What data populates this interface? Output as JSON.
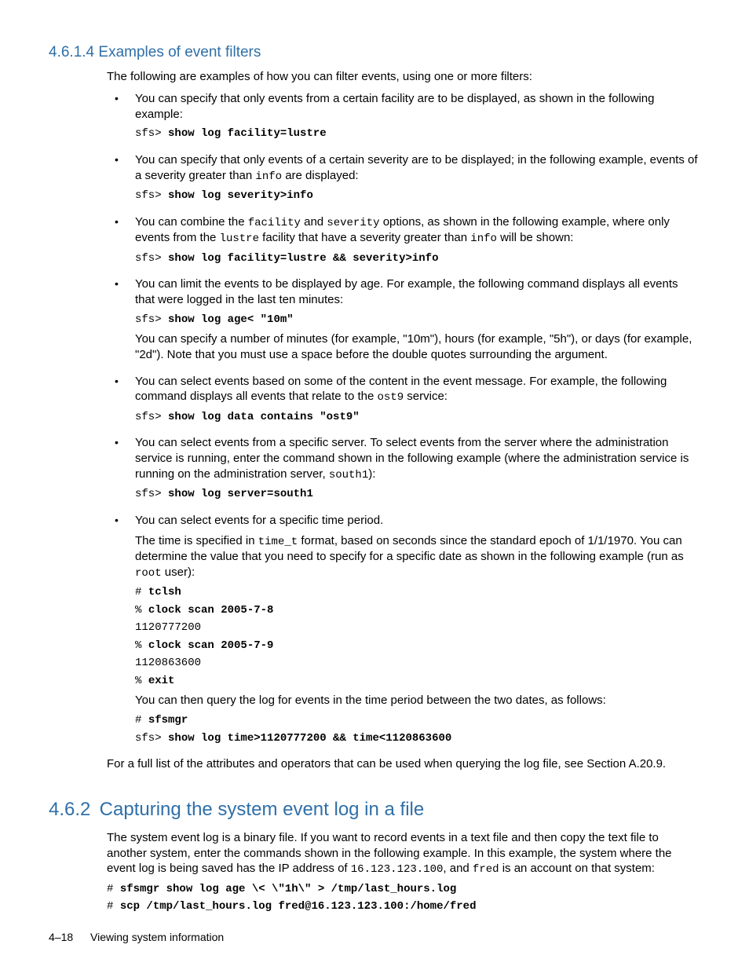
{
  "section1": {
    "number": "4.6.1.4",
    "title": "Examples of event filters",
    "intro": "The following are examples of how you can filter events, using one or more filters:",
    "bullets": [
      {
        "text1": "You can specify that only events from a certain facility are to be displayed, as shown in the following example:",
        "cmd1_prompt": "sfs> ",
        "cmd1_bold": "show log facility=lustre"
      },
      {
        "text1a": "You can specify that only events of a certain severity are to be displayed; in the following example, events of a severity greater than ",
        "text1_code": "info",
        "text1b": " are displayed:",
        "cmd1_prompt": "sfs> ",
        "cmd1_bold": "show log severity>info"
      },
      {
        "text1a": "You can combine the ",
        "code1": "facility",
        "text1b": " and ",
        "code2": "severity",
        "text1c": " options, as shown in the following example, where only events from the ",
        "code3": "lustre",
        "text1d": " facility that have a severity greater than ",
        "code4": "info",
        "text1e": " will be shown:",
        "cmd1_prompt": "sfs> ",
        "cmd1_bold": "show log facility=lustre && severity>info"
      },
      {
        "text1": "You can limit the events to be displayed by age. For example, the following command displays all events that were logged in the last ten minutes:",
        "cmd1_prompt": "sfs> ",
        "cmd1_bold": "show log age< \"10m\"",
        "text2": "You can specify a number of minutes (for example, \"10m\"), hours (for example, \"5h\"), or days (for example, \"2d\"). Note that you must use a space before the double quotes surrounding the argument."
      },
      {
        "text1a": "You can select events based on some of the content in the event message. For example, the following command displays all events that relate to the ",
        "code1": "ost9",
        "text1b": " service:",
        "cmd1_prompt": "sfs> ",
        "cmd1_bold": "show log data contains \"ost9\""
      },
      {
        "text1a": "You can select events from a specific server. To select events from the server where the administration service is running, enter the command shown in the following example (where the administration service is running on the administration server, ",
        "code1": "south1",
        "text1b": "):",
        "cmd1_prompt": "sfs> ",
        "cmd1_bold": "show log server=south1"
      },
      {
        "text1": "You can select events for a specific time period.",
        "text2a": "The time is specified in ",
        "code1": "time_t",
        "text2b": " format, based on seconds since the standard epoch of 1/1/1970. You can determine the value that you need to specify for a specific date as shown in the following example (run as ",
        "code2": "root",
        "text2c": " user):",
        "block1": [
          {
            "prompt": "# ",
            "bold": "tclsh"
          },
          {
            "prompt": "% ",
            "bold": "clock scan 2005-7-8"
          },
          {
            "plain": "1120777200"
          },
          {
            "prompt": "% ",
            "bold": "clock scan 2005-7-9"
          },
          {
            "plain": "1120863600"
          },
          {
            "prompt": "% ",
            "bold": "exit"
          }
        ],
        "text3": "You can then query the log for events in the time period between the two dates, as follows:",
        "block2": [
          {
            "prompt": "# ",
            "bold": "sfsmgr"
          },
          {
            "prompt": "sfs> ",
            "bold": "show log time>1120777200 && time<1120863600"
          }
        ]
      }
    ],
    "closing": "For a full list of the attributes and operators that can be used when querying the log file, see Section A.20.9."
  },
  "section2": {
    "number": "4.6.2",
    "title": "Capturing the system event log in a file",
    "para_a": "The system event log is a binary file. If you want to record events in a text file and then copy the text file to another system, enter the commands shown in the following example. In this example, the system where the event log is being saved has the IP address of ",
    "code1": "16.123.123.100",
    "para_b": ", and ",
    "code2": "fred",
    "para_c": " is an account on that system:",
    "block": [
      {
        "prompt": "# ",
        "bold": "sfsmgr show log age \\< \\\"1h\\\" > /tmp/last_hours.log"
      },
      {
        "prompt": "# ",
        "bold": "scp /tmp/last_hours.log fred@16.123.123.100:/home/fred"
      }
    ]
  },
  "footer": {
    "page": "4–18",
    "title": "Viewing system information"
  }
}
